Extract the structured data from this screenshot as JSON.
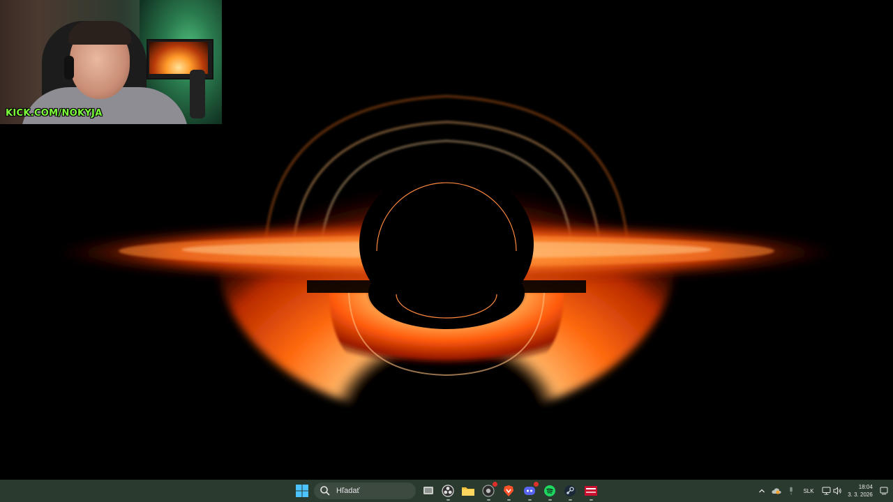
{
  "webcam": {
    "handle_text": "KICK.COM/NOKYJA"
  },
  "taskbar": {
    "search_placeholder": "Hľadať",
    "pinned_apps": [
      {
        "name": "task-view",
        "icon": "task-view-icon"
      },
      {
        "name": "obs",
        "icon": "obs-icon"
      },
      {
        "name": "file-explorer",
        "icon": "folder-icon"
      },
      {
        "name": "chrome",
        "icon": "chrome-icon"
      },
      {
        "name": "brave",
        "icon": "brave-icon"
      },
      {
        "name": "discord",
        "icon": "discord-icon"
      },
      {
        "name": "spotify",
        "icon": "spotify-icon"
      },
      {
        "name": "steam",
        "icon": "steam-icon"
      },
      {
        "name": "voicemeeter",
        "icon": "voicemeeter-icon"
      }
    ],
    "tray": {
      "language": "SLK",
      "time": "18:04",
      "date": "3. 3. 2026"
    }
  },
  "colors": {
    "taskbar_bg": "#2b3a2f",
    "disk_hot": "#ffc070",
    "disk_mid": "#ff6a10",
    "disk_edge": "#8a1500",
    "accent_green": "#7cff3a"
  }
}
